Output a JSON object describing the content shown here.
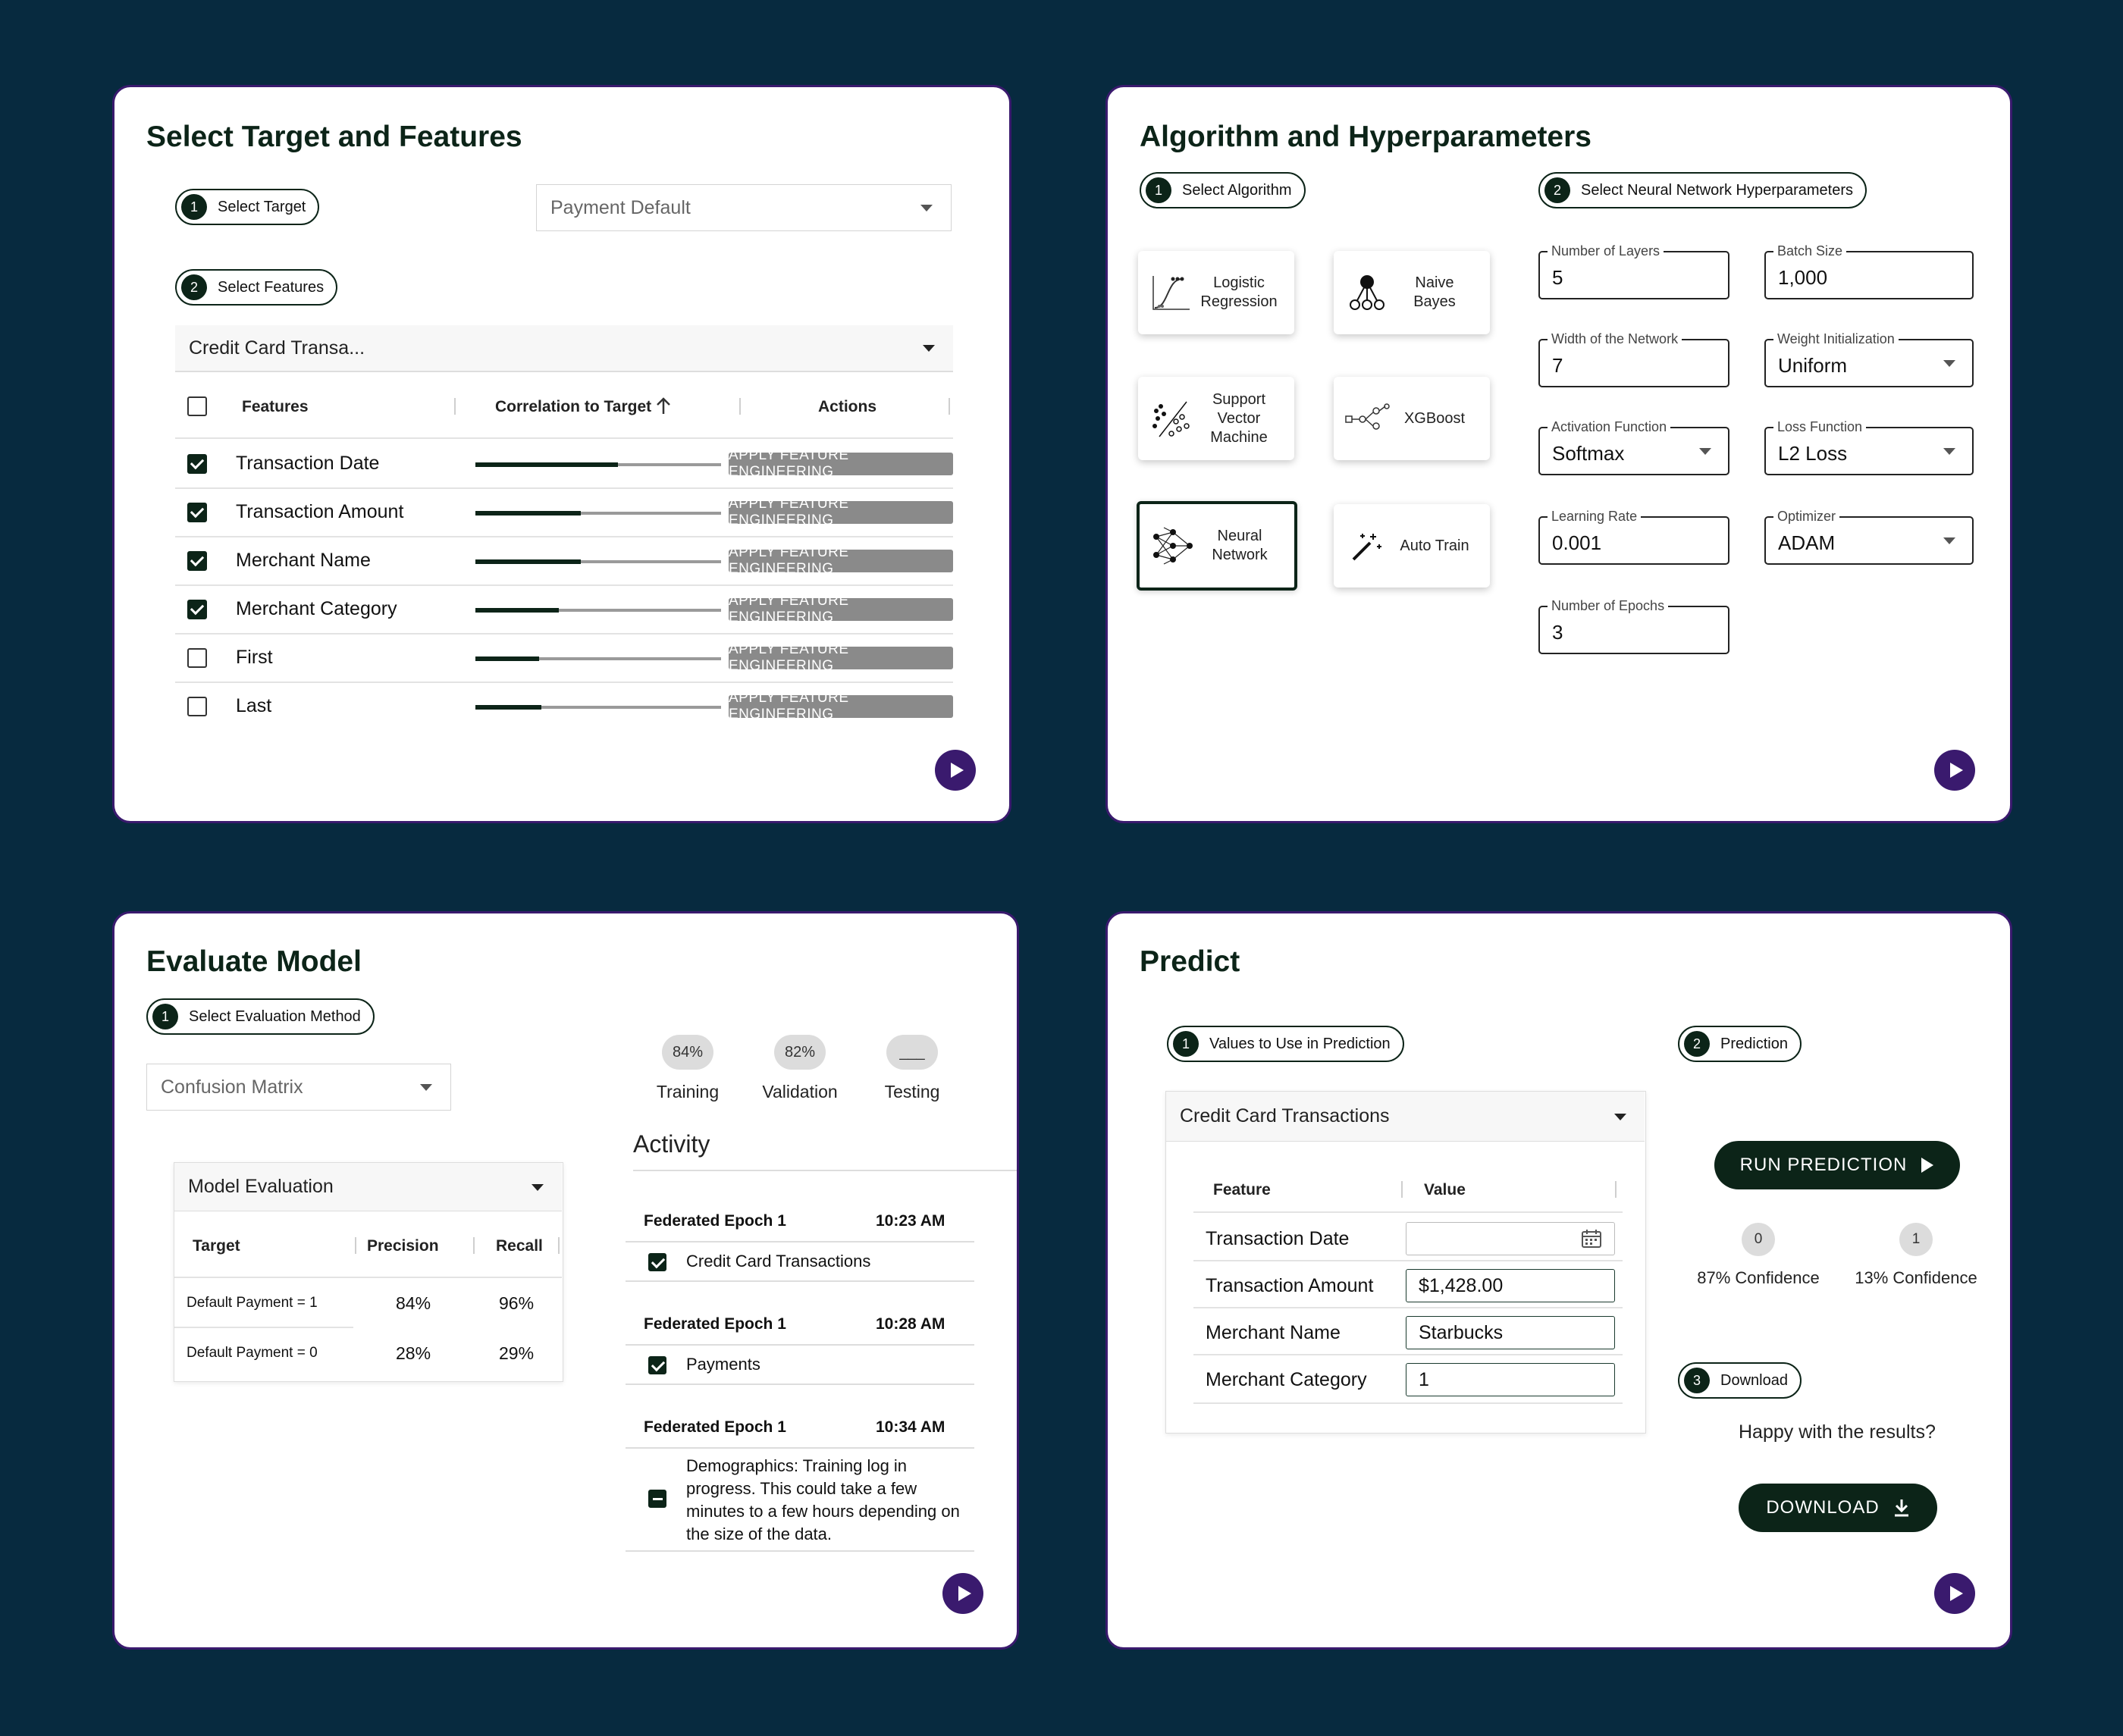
{
  "colors": {
    "background": "#072a3f",
    "card_border": "#3a1a6e",
    "primary_dark": "#0c2418",
    "play_button": "#3a1a6e",
    "feature_button": "#8a8a8a"
  },
  "card1": {
    "title": "Select Target and Features",
    "step1": {
      "num": "1",
      "label": "Select Target"
    },
    "target_select": "Payment Default",
    "step2": {
      "num": "2",
      "label": "Select Features"
    },
    "dataset_select": "Credit Card Transa...",
    "table_headers": {
      "features": "Features",
      "correlation": "Correlation to Target",
      "actions": "Actions"
    },
    "rows": [
      {
        "name": "Transaction Date",
        "checked": true,
        "correlation": 0.58,
        "action": "APPLY FEATURE ENGINEERING"
      },
      {
        "name": "Transaction Amount",
        "checked": true,
        "correlation": 0.43,
        "action": "APPLY FEATURE ENGINEERING"
      },
      {
        "name": "Merchant Name",
        "checked": true,
        "correlation": 0.43,
        "action": "APPLY FEATURE ENGINEERING"
      },
      {
        "name": "Merchant Category",
        "checked": true,
        "correlation": 0.34,
        "action": "APPLY FEATURE ENGINEERING"
      },
      {
        "name": "First",
        "checked": false,
        "correlation": 0.26,
        "action": "APPLY FEATURE ENGINEERING"
      },
      {
        "name": "Last",
        "checked": false,
        "correlation": 0.27,
        "action": "APPLY FEATURE ENGINEERING"
      }
    ]
  },
  "card2": {
    "title": "Algorithm and Hyperparameters",
    "step1": {
      "num": "1",
      "label": "Select Algorithm"
    },
    "step2": {
      "num": "2",
      "label": "Select Neural Network Hyperparameters"
    },
    "algorithms": {
      "logistic": "Logistic Regression",
      "naive": "Naive Bayes",
      "svm": "Support Vector Machine",
      "xgboost": "XGBoost",
      "neural": "Neural Network",
      "auto": "Auto Train"
    },
    "selected_algorithm": "Neural Network",
    "hyperparameters": {
      "layers": {
        "label": "Number of Layers",
        "value": "5"
      },
      "batch": {
        "label": "Batch Size",
        "value": "1,000"
      },
      "width": {
        "label": "Width of the Network",
        "value": "7"
      },
      "weight_init": {
        "label": "Weight Initialization",
        "value": "Uniform"
      },
      "activation": {
        "label": "Activation Function",
        "value": "Softmax"
      },
      "loss": {
        "label": "Loss Function",
        "value": "L2 Loss"
      },
      "lr": {
        "label": "Learning Rate",
        "value": "0.001"
      },
      "optimizer": {
        "label": "Optimizer",
        "value": "ADAM"
      },
      "epochs": {
        "label": "Number of Epochs",
        "value": "3"
      }
    }
  },
  "card3": {
    "title": "Evaluate Model",
    "step1": {
      "num": "1",
      "label": "Select Evaluation Method"
    },
    "method_select": "Confusion Matrix",
    "metrics": [
      {
        "value": "84%",
        "label": "Training"
      },
      {
        "value": "82%",
        "label": "Validation"
      },
      {
        "value": "___",
        "label": "Testing"
      }
    ],
    "eval_select": "Model Evaluation",
    "eval_headers": {
      "target": "Target",
      "precision": "Precision",
      "recall": "Recall"
    },
    "eval_rows": [
      {
        "target": "Default Payment = 1",
        "precision": "84%",
        "recall": "96%"
      },
      {
        "target": "Default Payment = 0",
        "precision": "28%",
        "recall": "29%"
      }
    ],
    "activity_title": "Activity",
    "activity": [
      {
        "epoch": "Federated Epoch 1",
        "time": "10:23 AM",
        "item": "Credit Card Transactions",
        "state": "checked"
      },
      {
        "epoch": "Federated Epoch 1",
        "time": "10:28 AM",
        "item": "Payments",
        "state": "checked"
      },
      {
        "epoch": "Federated Epoch 1",
        "time": "10:34 AM",
        "item": "Demographics: Training log in progress. This could take a few minutes to a few hours depending on the size of the data.",
        "state": "indeterminate"
      }
    ]
  },
  "card4": {
    "title": "Predict",
    "step1": {
      "num": "1",
      "label": "Values to Use in Prediction"
    },
    "step2": {
      "num": "2",
      "label": "Prediction"
    },
    "step3": {
      "num": "3",
      "label": "Download"
    },
    "dataset_select": "Credit Card Transactions",
    "headers": {
      "feature": "Feature",
      "value": "Value"
    },
    "rows": [
      {
        "feature": "Transaction Date",
        "value": ""
      },
      {
        "feature": "Transaction Amount",
        "value": "$1,428.00"
      },
      {
        "feature": "Merchant Name",
        "value": "Starbucks"
      },
      {
        "feature": "Merchant Category",
        "value": "1"
      }
    ],
    "run_label": "RUN PREDICTION",
    "outcomes": [
      {
        "class": "0",
        "confidence": "87% Confidence"
      },
      {
        "class": "1",
        "confidence": "13% Confidence"
      }
    ],
    "happy_text": "Happy with the results?",
    "download_label": "DOWNLOAD"
  }
}
